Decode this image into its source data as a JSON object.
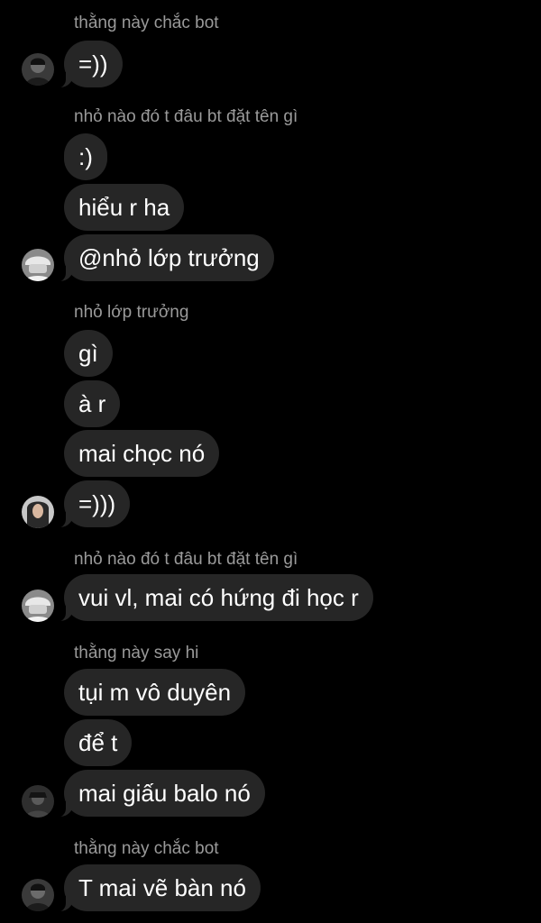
{
  "messages": [
    {
      "sender": "thằng này chắc bot"
    },
    {
      "text": "=))"
    },
    {
      "sender": "nhỏ nào đó t đâu bt đặt tên gì"
    },
    {
      "text": ":)"
    },
    {
      "text": "hiểu r ha"
    },
    {
      "text": "@nhỏ lớp trưởng"
    },
    {
      "sender": "nhỏ lớp trưởng"
    },
    {
      "text": "gì"
    },
    {
      "text": "à r"
    },
    {
      "text": "mai chọc nó"
    },
    {
      "text": "=)))"
    },
    {
      "sender": "nhỏ nào đó t đâu bt đặt tên gì"
    },
    {
      "text": "vui vl, mai có hứng đi học r"
    },
    {
      "sender": "thằng này say hi"
    },
    {
      "text": "tụi m vô duyên"
    },
    {
      "text": "để t"
    },
    {
      "text": "mai giấu balo nó"
    },
    {
      "sender": "thằng này chắc bot"
    },
    {
      "text": "T mai vẽ bàn nó"
    }
  ],
  "colors": {
    "background": "#000000",
    "bubble": "#262626",
    "sender_text": "#9a9a9a",
    "message_text": "#ffffff"
  },
  "avatars": [
    "profile-photo-dark",
    "profile-photo-white-hat",
    "profile-photo-girl",
    "profile-photo-white-hat",
    "profile-photo-dark-2",
    "profile-photo-dark"
  ]
}
